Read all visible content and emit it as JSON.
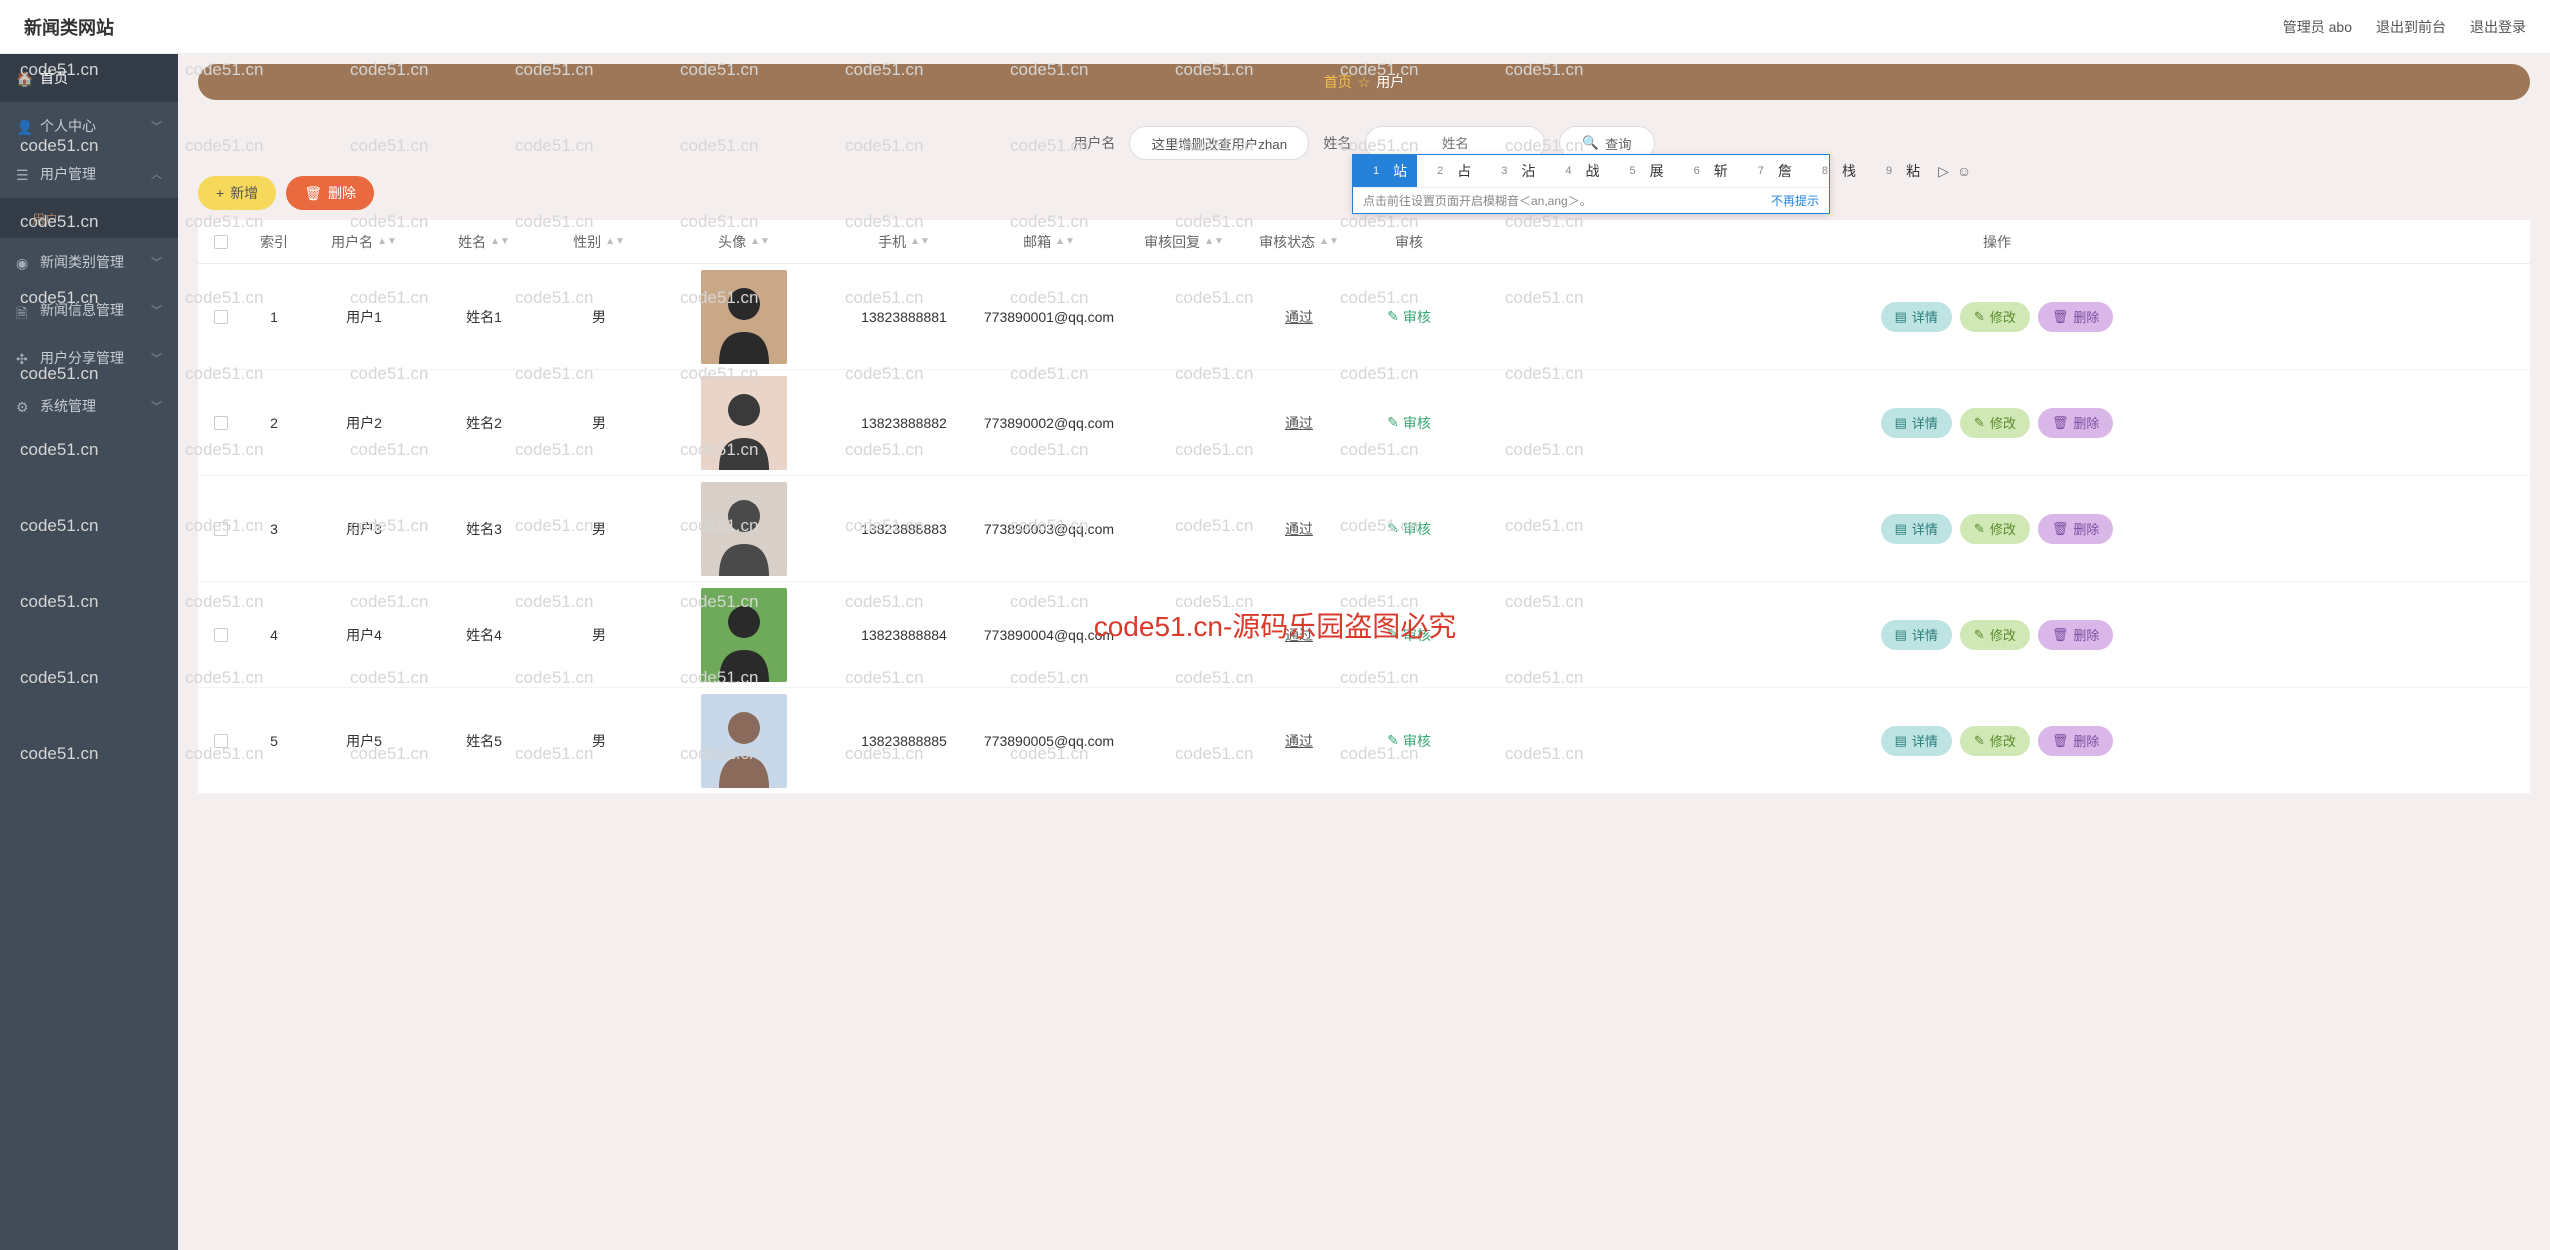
{
  "topbar": {
    "title": "新闻类网站",
    "admin": "管理员 abo",
    "front": "退出到前台",
    "logout": "退出登录"
  },
  "sidebar": {
    "items": [
      {
        "label": "首页",
        "icon": "home"
      },
      {
        "label": "个人中心",
        "icon": "user",
        "expandable": true
      },
      {
        "label": "用户管理",
        "icon": "list",
        "expandable": true,
        "open": true
      },
      {
        "label": "新闻类别管理",
        "icon": "dashboard",
        "expandable": true
      },
      {
        "label": "新闻信息管理",
        "icon": "doc",
        "expandable": true
      },
      {
        "label": "用户分享管理",
        "icon": "share",
        "expandable": true
      },
      {
        "label": "系统管理",
        "icon": "gear",
        "expandable": true
      }
    ],
    "subitem": "用户"
  },
  "breadcrumb": {
    "home": "首页",
    "sep": "☆",
    "current": "用户"
  },
  "search": {
    "label1": "用户名",
    "input1": "这里增删改查用户zhan",
    "label2": "姓名",
    "input2": "姓名",
    "btn": "查询"
  },
  "ime": {
    "candidates": [
      {
        "n": "1",
        "t": "站"
      },
      {
        "n": "2",
        "t": "占"
      },
      {
        "n": "3",
        "t": "沾"
      },
      {
        "n": "4",
        "t": "战"
      },
      {
        "n": "5",
        "t": "展"
      },
      {
        "n": "6",
        "t": "斩"
      },
      {
        "n": "7",
        "t": "詹"
      },
      {
        "n": "8",
        "t": "栈"
      },
      {
        "n": "9",
        "t": "粘"
      }
    ],
    "hint": "点击前往设置页面开启模糊音＜an,ang＞。",
    "dismiss": "不再提示"
  },
  "actions": {
    "add": "新增",
    "del": "删除"
  },
  "table": {
    "headers": {
      "idx": "索引",
      "user": "用户名",
      "name": "姓名",
      "gender": "性别",
      "avatar": "头像",
      "phone": "手机",
      "email": "邮箱",
      "reply": "审核回复",
      "status": "审核状态",
      "audit": "审核",
      "ops": "操作"
    },
    "audit_label": "审核",
    "op_detail": "详情",
    "op_edit": "修改",
    "op_delete": "删除",
    "rows": [
      {
        "idx": "1",
        "user": "用户1",
        "name": "姓名1",
        "gender": "男",
        "phone": "13823888881",
        "email": "773890001@qq.com",
        "reply": "",
        "status": "通过"
      },
      {
        "idx": "2",
        "user": "用户2",
        "name": "姓名2",
        "gender": "男",
        "phone": "13823888882",
        "email": "773890002@qq.com",
        "reply": "",
        "status": "通过"
      },
      {
        "idx": "3",
        "user": "用户3",
        "name": "姓名3",
        "gender": "男",
        "phone": "13823888883",
        "email": "773890003@qq.com",
        "reply": "",
        "status": "通过"
      },
      {
        "idx": "4",
        "user": "用户4",
        "name": "姓名4",
        "gender": "男",
        "phone": "13823888884",
        "email": "773890004@qq.com",
        "reply": "",
        "status": "通过"
      },
      {
        "idx": "5",
        "user": "用户5",
        "name": "姓名5",
        "gender": "男",
        "phone": "13823888885",
        "email": "773890005@qq.com",
        "reply": "",
        "status": "通过"
      }
    ]
  },
  "watermark": {
    "small": "code51.cn",
    "big": "code51.cn-源码乐园盗图必究"
  }
}
